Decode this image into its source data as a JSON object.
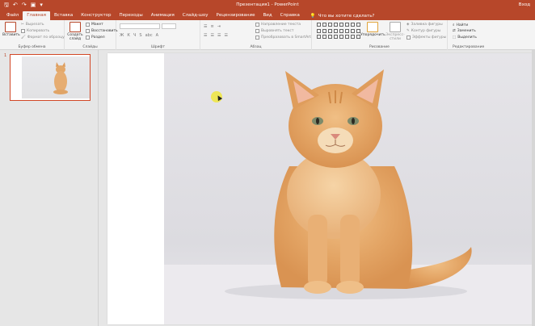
{
  "window": {
    "title": "Презентация1 - PowerPoint",
    "user": "Вход"
  },
  "quick_access": {
    "icons": [
      "save-icon",
      "undo-icon",
      "redo-icon",
      "start-from-beginning-icon",
      "customize-icon"
    ]
  },
  "tabs": [
    {
      "label": "Файл"
    },
    {
      "label": "Главная"
    },
    {
      "label": "Вставка"
    },
    {
      "label": "Конструктор"
    },
    {
      "label": "Переходы"
    },
    {
      "label": "Анимация"
    },
    {
      "label": "Слайд-шоу"
    },
    {
      "label": "Рецензирование"
    },
    {
      "label": "Вид"
    },
    {
      "label": "Справка"
    }
  ],
  "tell_me": {
    "label": "Что вы хотите сделать?"
  },
  "ribbon": {
    "clipboard": {
      "name": "Буфер обмена",
      "paste": "Вставить",
      "cut": "Вырезать",
      "copy": "Копировать",
      "format_painter": "Формат по образцу"
    },
    "slides": {
      "name": "Слайды",
      "new_slide": "Создать слайд",
      "layout": "Макет",
      "reset": "Восстановить",
      "section": "Раздел"
    },
    "font": {
      "name": "Шрифт"
    },
    "paragraph": {
      "name": "Абзац",
      "text_direction": "Направление текста",
      "align_text": "Выровнять текст",
      "smartart": "Преобразовать в SmartArt"
    },
    "drawing": {
      "name": "Рисование",
      "arrange": "Упорядочить",
      "quick_styles": "Экспресс-стили",
      "shape_fill": "Заливка фигуры",
      "shape_outline": "Контур фигуры",
      "shape_effects": "Эффекты фигуры"
    },
    "editing": {
      "name": "Редактирование",
      "find": "Найти",
      "replace": "Заменить",
      "select": "Выделить"
    }
  },
  "slides_pane": {
    "number": "1"
  },
  "colors": {
    "accent": "#b7472a",
    "ribbon_bg": "#f4f4f4",
    "workspace": "#e6e6e6"
  }
}
